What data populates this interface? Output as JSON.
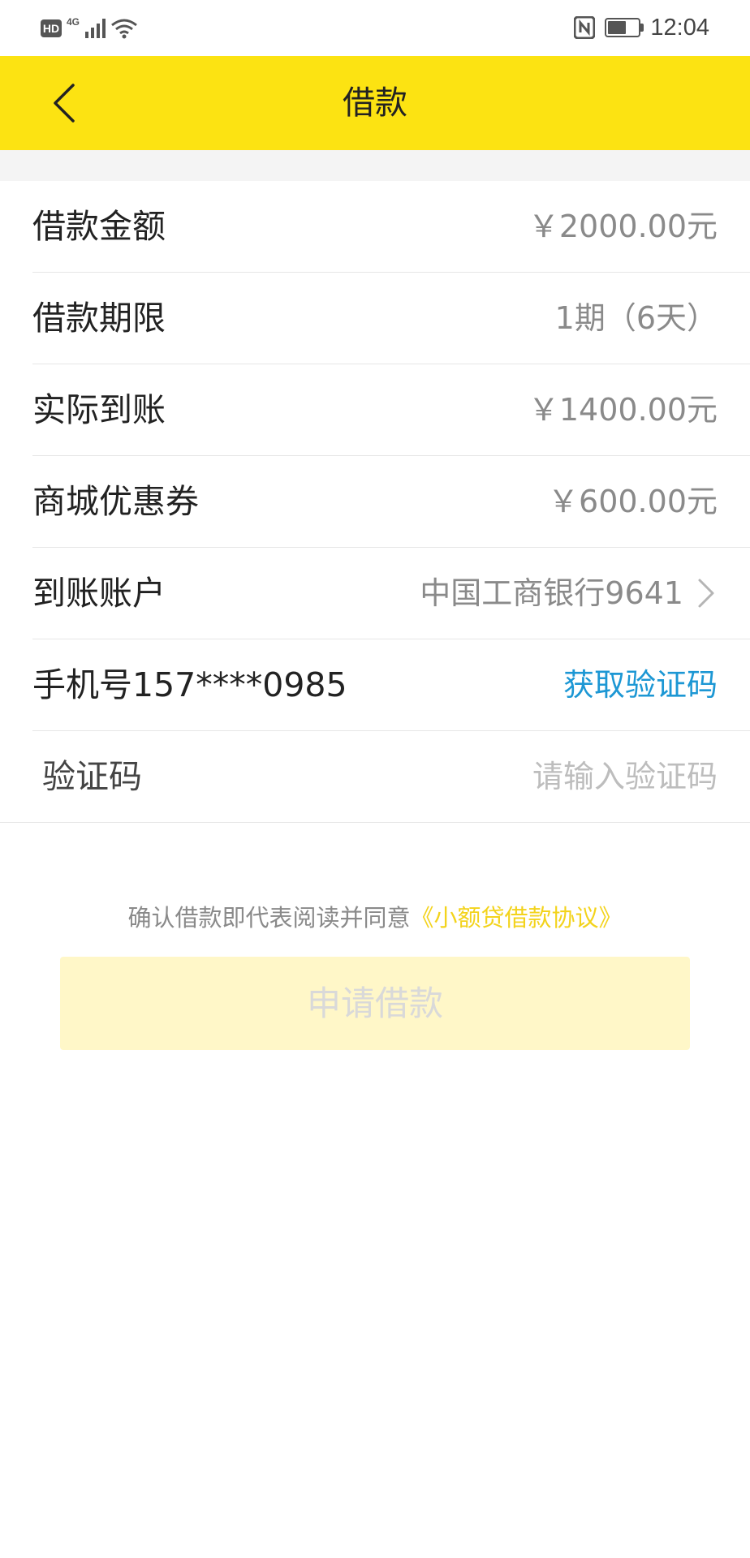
{
  "status_bar": {
    "hd": "HD",
    "network": "4G",
    "battery_level": 0.65,
    "time": "12:04",
    "icons": [
      "hd-icon",
      "signal-icon",
      "wifi-icon",
      "nfc-icon",
      "battery-icon"
    ]
  },
  "header": {
    "title": "借款",
    "background": "#fce312",
    "back_icon": "chevron-left-icon"
  },
  "loan": {
    "amount_label": "借款金额",
    "amount_value": "￥2000.00元",
    "term_label": "借款期限",
    "term_value": "1期（6天）",
    "actual_label": "实际到账",
    "actual_value": "￥1400.00元",
    "coupon_label": "商城优惠券",
    "coupon_value": "￥600.00元",
    "account_label": "到账账户",
    "account_value": "中国工商银行9641",
    "phone_label": "手机号157****0985",
    "get_code": "获取验证码",
    "code_label": "验证码",
    "code_placeholder": "请输入验证码"
  },
  "agreement": {
    "text": "确认借款即代表阅读并同意",
    "link": "《小额贷借款协议》"
  },
  "submit": {
    "label": "申请借款"
  },
  "colors": {
    "accent": "#fce312",
    "link": "#1c97d4",
    "agreement_link": "#f3d31c",
    "disabled_button": "#fff7c8"
  }
}
